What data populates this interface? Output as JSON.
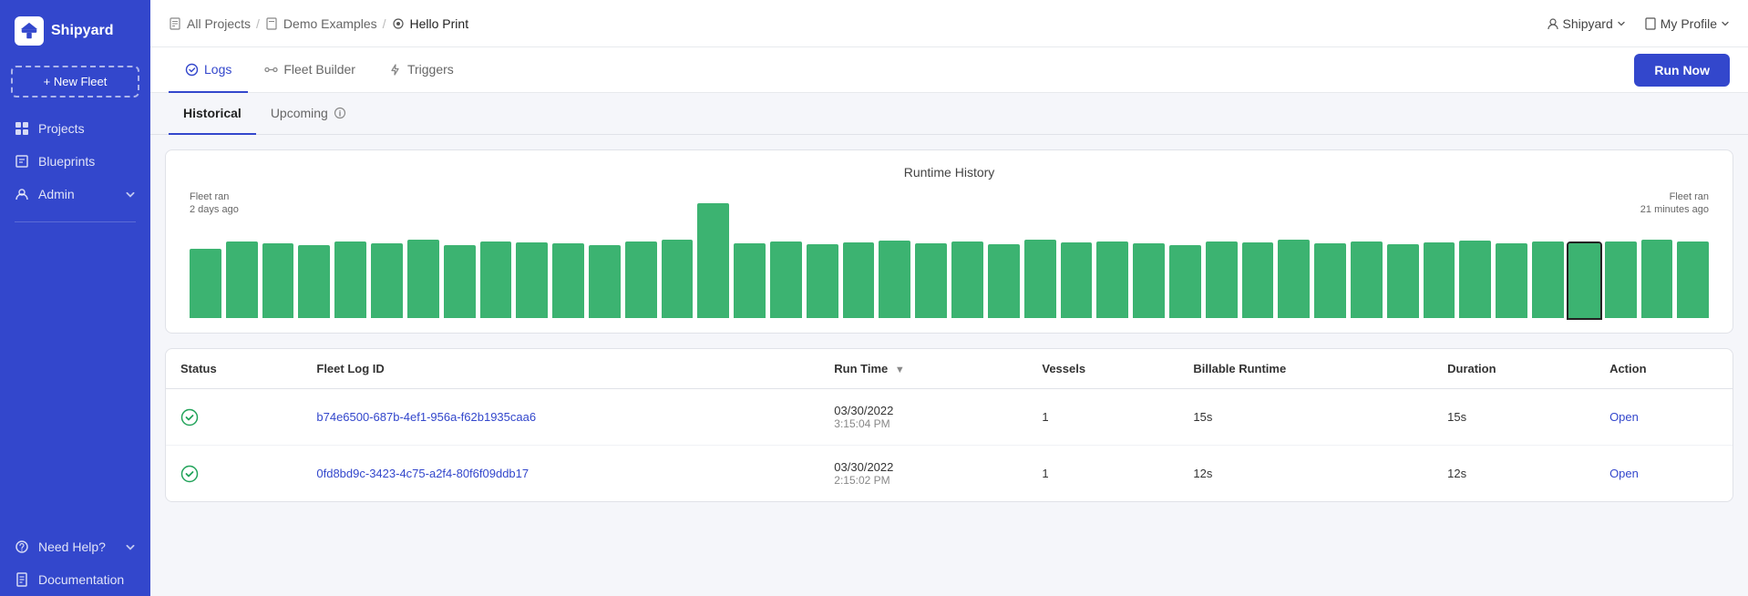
{
  "sidebar": {
    "logo_text": "Shipyard",
    "new_fleet_label": "+ New Fleet",
    "nav_items": [
      {
        "id": "projects",
        "label": "Projects",
        "icon": "grid-icon"
      },
      {
        "id": "blueprints",
        "label": "Blueprints",
        "icon": "blueprint-icon"
      },
      {
        "id": "admin",
        "label": "Admin",
        "icon": "admin-icon",
        "has_arrow": true
      }
    ],
    "bottom_items": [
      {
        "id": "need-help",
        "label": "Need Help?",
        "icon": "help-icon",
        "has_arrow": true
      },
      {
        "id": "documentation",
        "label": "Documentation",
        "icon": "doc-icon"
      }
    ]
  },
  "topbar": {
    "breadcrumb": {
      "all_projects": "All Projects",
      "demo_examples": "Demo Examples",
      "current": "Hello Print"
    },
    "org_label": "Shipyard",
    "profile_label": "My Profile"
  },
  "tabs": [
    {
      "id": "logs",
      "label": "Logs",
      "active": true
    },
    {
      "id": "fleet-builder",
      "label": "Fleet Builder",
      "active": false
    },
    {
      "id": "triggers",
      "label": "Triggers",
      "active": false
    }
  ],
  "run_now_label": "Run Now",
  "sub_tabs": [
    {
      "id": "historical",
      "label": "Historical",
      "active": true
    },
    {
      "id": "upcoming",
      "label": "Upcoming",
      "active": false
    }
  ],
  "chart": {
    "title": "Runtime History",
    "annotation_left_line1": "Fleet ran",
    "annotation_left_line2": "2 days ago",
    "annotation_right_line1": "Fleet ran",
    "annotation_right_line2": "21 minutes ago",
    "bars": [
      75,
      80,
      78,
      82,
      76,
      80,
      77,
      79,
      81,
      78,
      80,
      75,
      79,
      82,
      120,
      78,
      80,
      76,
      79,
      81,
      78,
      80,
      77,
      82,
      79,
      80,
      78,
      76,
      80,
      79,
      82,
      78,
      80,
      77,
      79,
      81,
      78,
      80,
      "highlighted",
      80,
      78,
      82
    ]
  },
  "table": {
    "columns": [
      "Status",
      "Fleet Log ID",
      "Run Time",
      "Vessels",
      "Billable Runtime",
      "Duration",
      "Action"
    ],
    "rows": [
      {
        "status": "success",
        "log_id": "b74e6500-687b-4ef1-956a-f62b1935caa6",
        "run_time_date": "03/30/2022",
        "run_time_time": "3:15:04 PM",
        "vessels": "1",
        "billable_runtime": "15s",
        "duration": "15s",
        "action": "Open"
      },
      {
        "status": "success",
        "log_id": "0fd8bd9c-3423-4c75-a2f4-80f6f09ddb17",
        "run_time_date": "03/30/2022",
        "run_time_time": "2:15:02 PM",
        "vessels": "1",
        "billable_runtime": "12s",
        "duration": "12s",
        "action": "Open"
      }
    ]
  }
}
